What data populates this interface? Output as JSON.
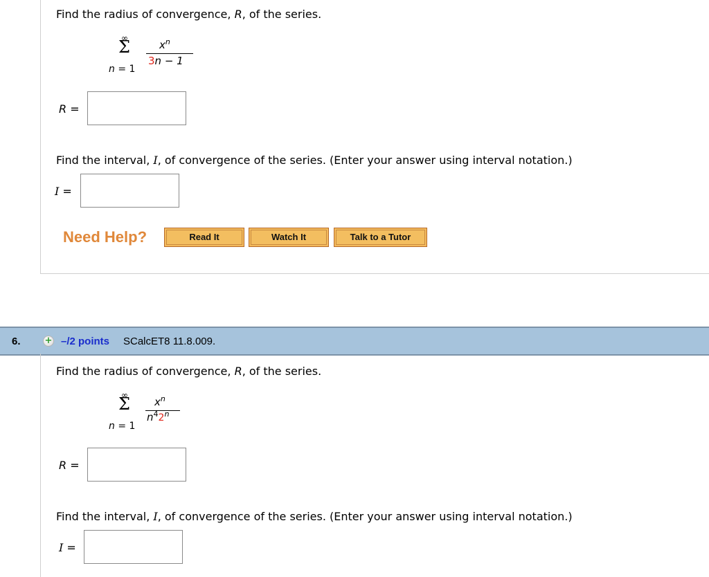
{
  "question5": {
    "radius_prompt": {
      "before": "Find the radius of convergence, ",
      "var": "R",
      "after": ", of the series."
    },
    "series": {
      "upper": "∞",
      "sigma": "Σ",
      "lower_var": "n",
      "lower_eq": " = 1",
      "numerator_base": "x",
      "numerator_exp": "n",
      "denominator_coef": "3",
      "denominator_rest": "n − 1"
    },
    "radius_answer": {
      "label_var": "R",
      "label_eq": " =",
      "value": ""
    },
    "interval_prompt": {
      "before": "Find the interval, ",
      "var": "I",
      "after": ", of convergence of the series. (Enter your answer using interval notation.)"
    },
    "interval_answer": {
      "label_var": "I",
      "label_eq": " =",
      "value": ""
    },
    "help": {
      "label": "Need Help?",
      "buttons": [
        "Read It",
        "Watch It",
        "Talk to a Tutor"
      ]
    }
  },
  "question6": {
    "header": {
      "number": "6.",
      "icon": "plus-circle-icon",
      "points": "–/2 points",
      "source": "SCalcET8 11.8.009."
    },
    "radius_prompt": {
      "before": "Find the radius of convergence, ",
      "var": "R",
      "after": ", of the series."
    },
    "series": {
      "upper": "∞",
      "sigma": "Σ",
      "lower_var": "n",
      "lower_eq": " = 1",
      "numerator_base": "x",
      "numerator_exp": "n",
      "denominator_base": "n",
      "denominator_exp": "4",
      "denominator_coef": "2",
      "denominator_coef_exp": "n"
    },
    "radius_answer": {
      "label_var": "R",
      "label_eq": " =",
      "value": ""
    },
    "interval_prompt": {
      "before": "Find the interval, ",
      "var": "I",
      "after": ", of convergence of the series. (Enter your answer using interval notation.)"
    },
    "interval_answer": {
      "label_var": "I",
      "label_eq": " =",
      "value": ""
    }
  },
  "colors": {
    "highlight_red": "#e0261b",
    "need_help_orange": "#e0883a",
    "button_fill": "#f3be60",
    "header_bg": "#a6c3dc",
    "points_blue": "#1a2dcc"
  }
}
